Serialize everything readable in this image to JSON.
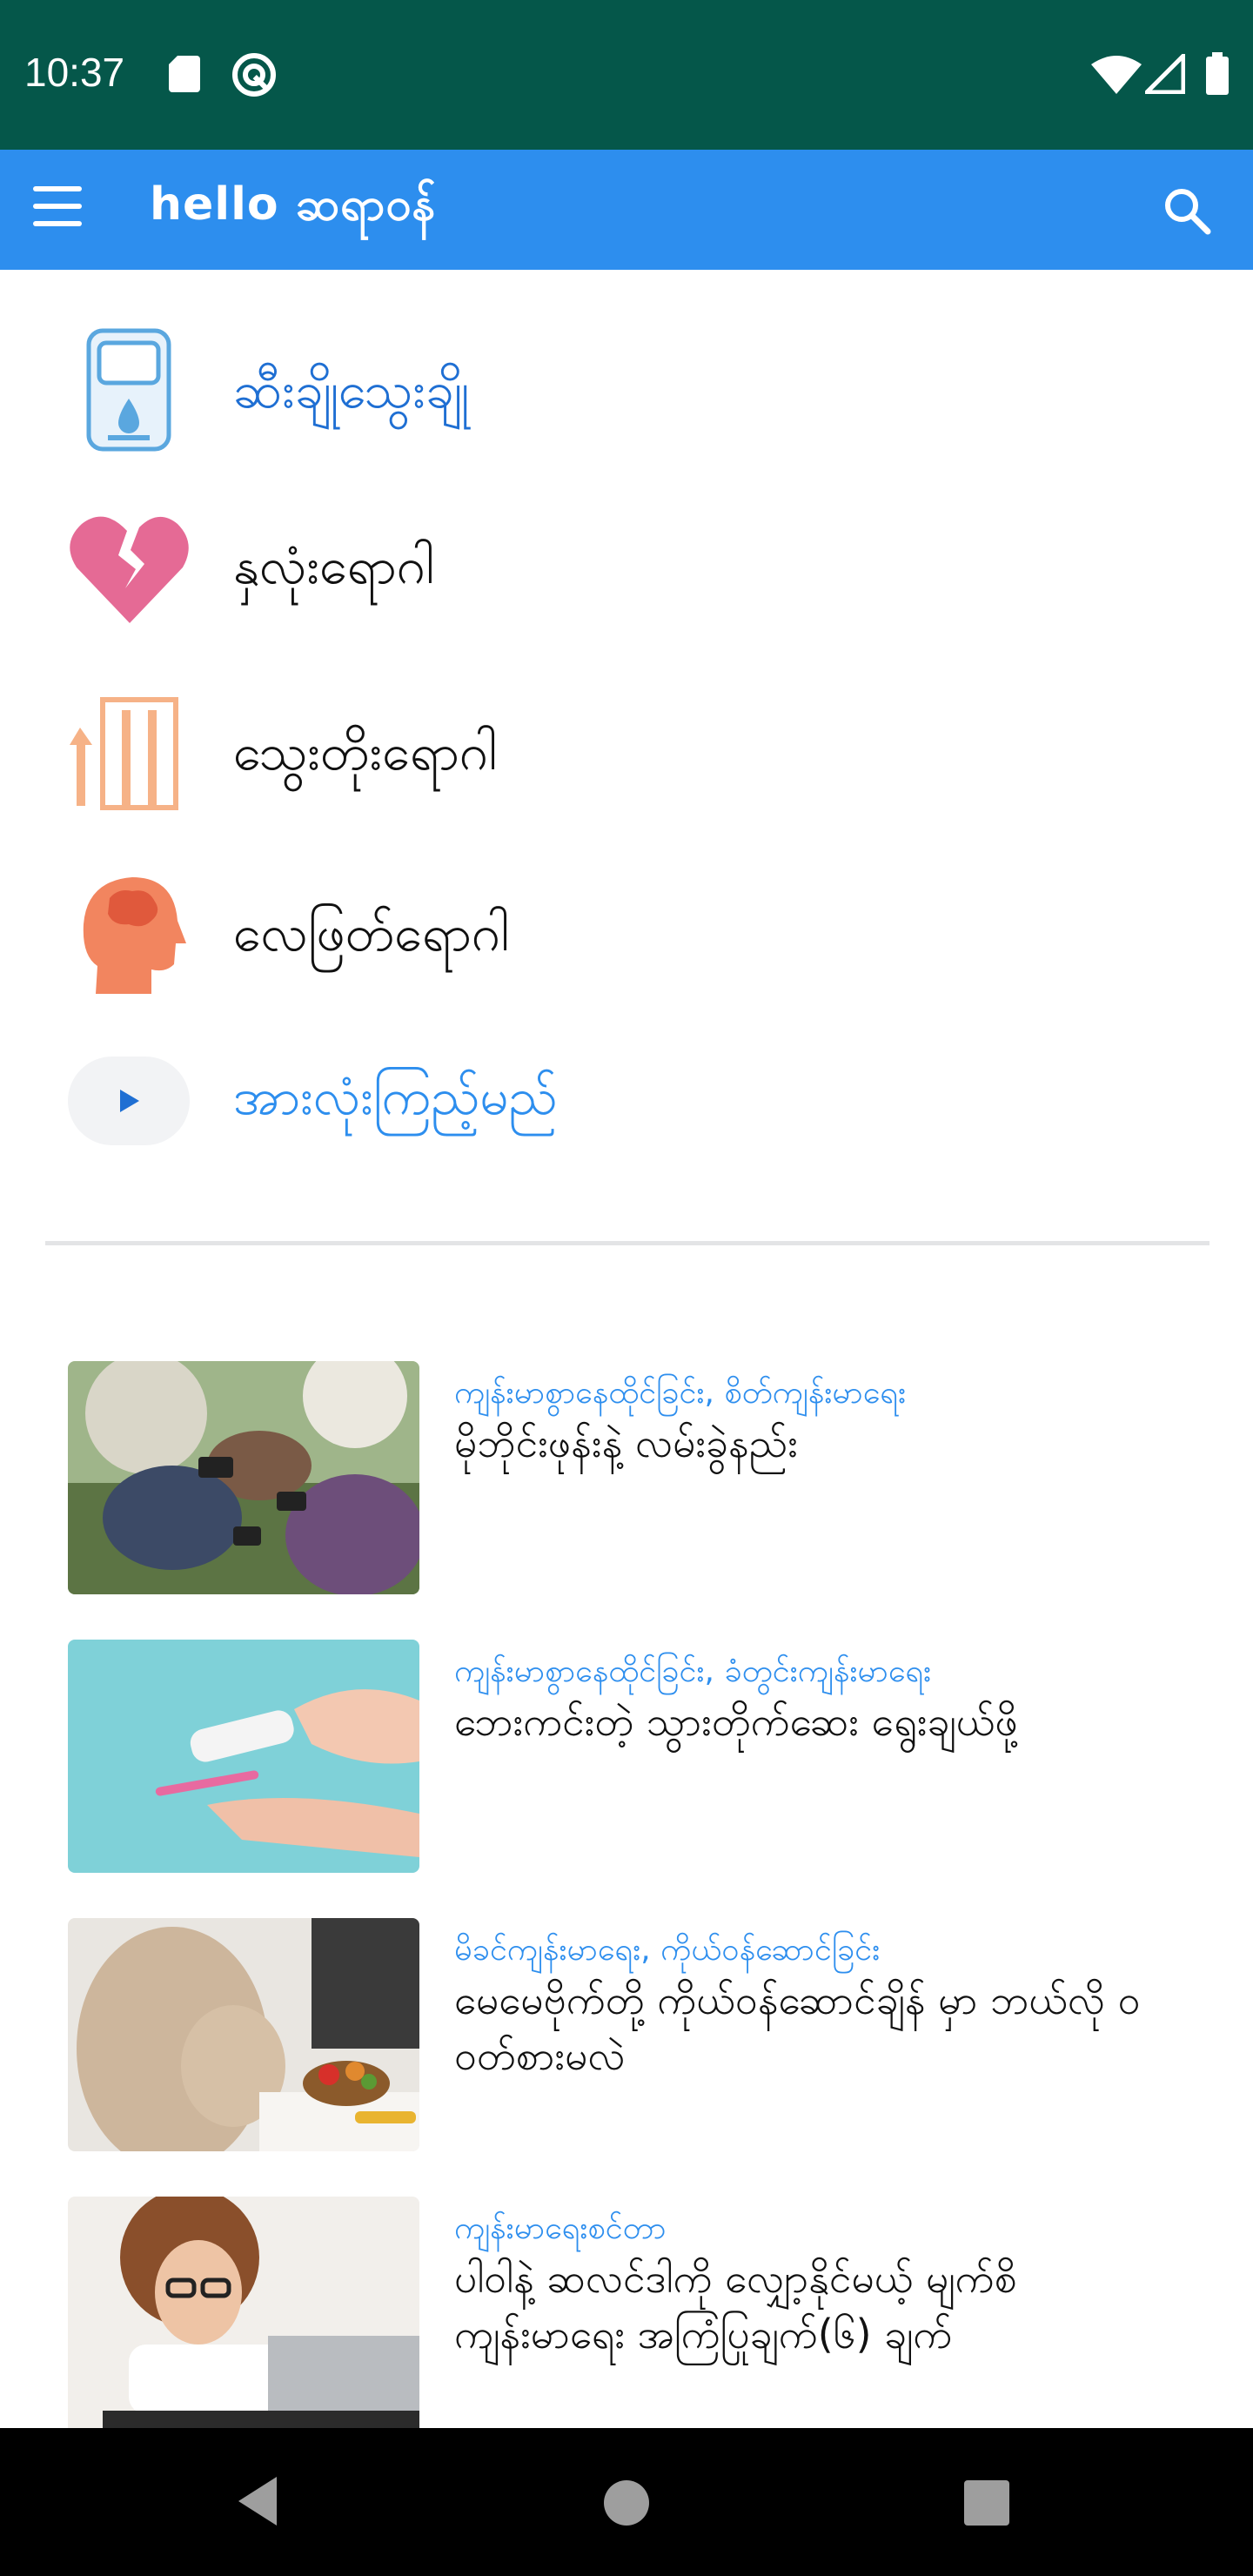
{
  "status_bar": {
    "time": "10:37",
    "icons": [
      "sd-card-icon",
      "sync-icon",
      "wifi-icon",
      "signal-icon",
      "battery-icon"
    ]
  },
  "app_bar": {
    "brand": "hello ဆရာဝန်",
    "menu_icon": "hamburger-menu-icon",
    "search_icon": "search-icon"
  },
  "categories": [
    {
      "label": "ဆီးချိုသွေးချို",
      "icon": "glucose-meter-icon",
      "color": "#1f6fd3"
    },
    {
      "label": "နှလုံးရောဂါ",
      "icon": "broken-heart-icon",
      "color": "#111111"
    },
    {
      "label": "သွေးတိုးရောဂါ",
      "icon": "blood-pressure-icon",
      "color": "#111111"
    },
    {
      "label": "လေဖြတ်ရောဂါ",
      "icon": "brain-head-icon",
      "color": "#111111"
    }
  ],
  "see_all": {
    "label": "အားလုံးကြည့်မည်",
    "icon": "play-icon"
  },
  "articles": [
    {
      "category": "ကျန်းမာစွာနေထိုင်ခြင်း, စိတ်ကျန်းမာရေး",
      "title": "မိုဘိုင်းဖုန်းနဲ့ လမ်းခွဲနည်း",
      "thumb": "people-with-phones-photo"
    },
    {
      "category": "ကျန်းမာစွာနေထိုင်ခြင်း, ခံတွင်းကျန်းမာရေး",
      "title": "ဘေးကင်းတဲ့ သွားတိုက်ဆေး ရွေးချယ်ဖို့",
      "thumb": "toothpaste-photo"
    },
    {
      "category": "မိခင်ကျန်းမာရေး, ကိုယ်ဝန်ဆောင်ခြင်း",
      "title": "မေမေဗိုက်တို့ ကိုယ်ဝန်ဆောင်ချိန် မှာ ဘယ်လို ဝဝတ်စားမလဲ",
      "thumb": "pregnant-woman-photo"
    },
    {
      "category": "ကျန်းမာရေးစင်တာ",
      "title": "ပါဝါနဲ့ ဆလင်ဒါကို လျှော့နိုင်မယ့် မျက်စိ ကျန်းမာရေး အကြံပြုချက်(၆) ချက်",
      "thumb": "woman-laptop-glasses-photo"
    }
  ],
  "nav_bar": {
    "buttons": [
      "back-icon",
      "home-icon",
      "recents-icon"
    ]
  }
}
